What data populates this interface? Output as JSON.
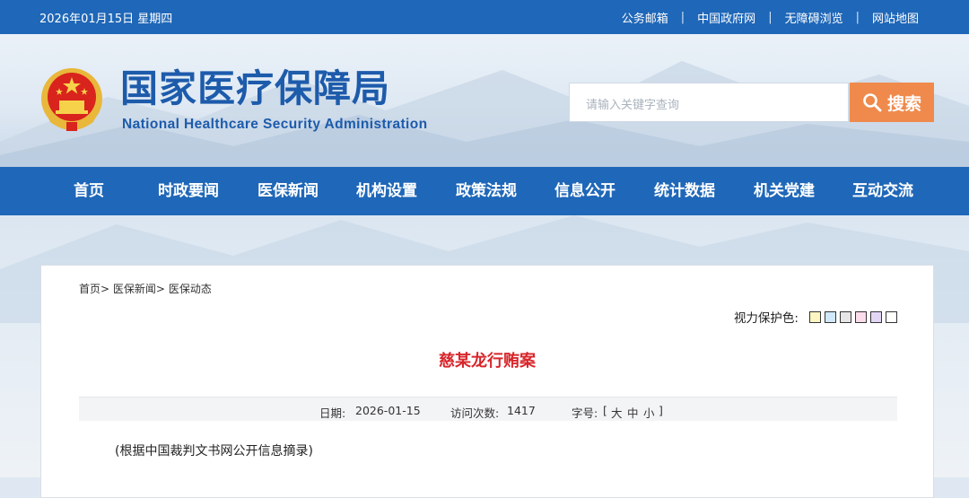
{
  "topbar": {
    "date": "2026年01月15日 星期四",
    "links": [
      "公务邮箱",
      "中国政府网",
      "无障碍浏览",
      "网站地图"
    ],
    "separator": "|"
  },
  "header": {
    "title": "国家医疗保障局",
    "subtitle": "National Healthcare Security Administration",
    "search_placeholder": "请输入关键字查询",
    "search_label": "搜索"
  },
  "nav": {
    "items": [
      "首页",
      "时政要闻",
      "医保新闻",
      "机构设置",
      "政策法规",
      "信息公开",
      "统计数据",
      "机关党建",
      "互动交流"
    ]
  },
  "breadcrumb": {
    "items": [
      "首页",
      "医保新闻",
      "医保动态"
    ],
    "sep": ">"
  },
  "vision": {
    "label": "视力保护色:",
    "colors": [
      "#fbf6c2",
      "#cfe8fb",
      "#e6e6e6",
      "#fadcea",
      "#e3d6f5",
      "#ffffff"
    ]
  },
  "article": {
    "title": "慈某龙行贿案",
    "date_label": "日期:",
    "date": "2026-01-15",
    "visits_label": "访问次数:",
    "visits": "1417",
    "font_label": "字号:",
    "font_open": "[",
    "font_large": "大",
    "font_medium": "中",
    "font_small": "小",
    "font_close": "]",
    "lead": "(根据中国裁判文书网公开信息摘录)"
  }
}
